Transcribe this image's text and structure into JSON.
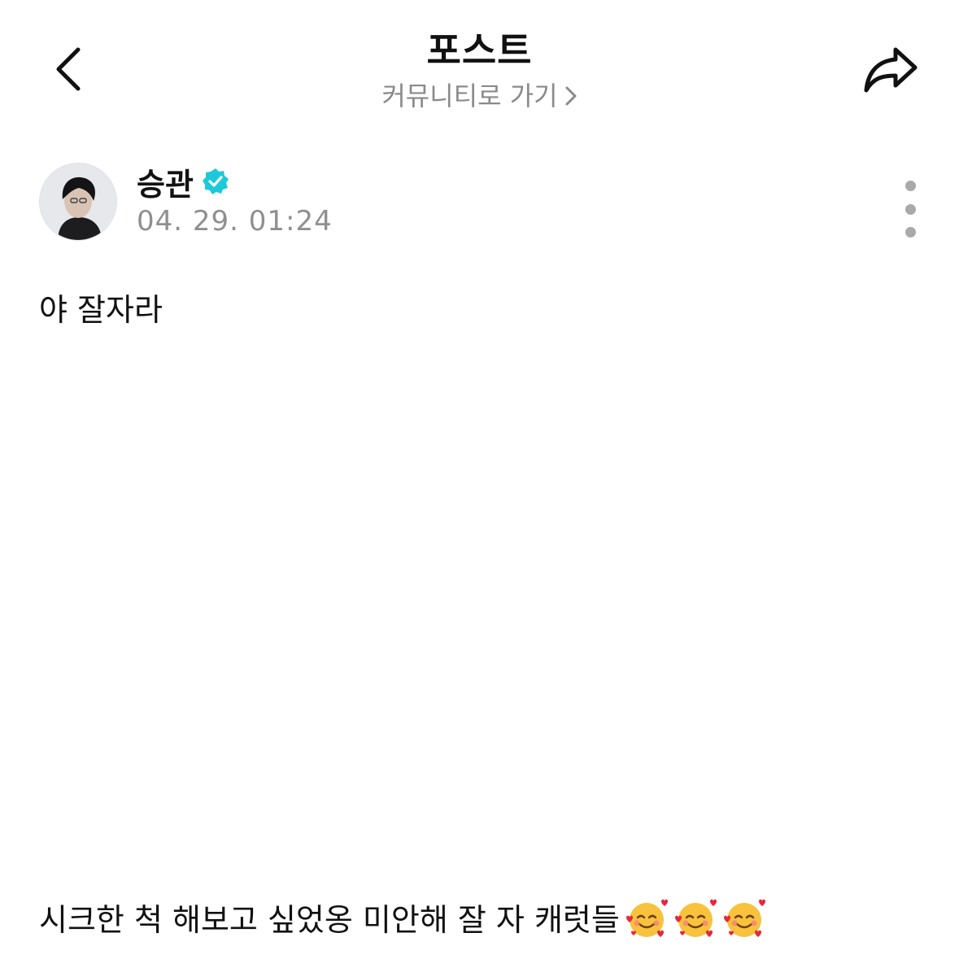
{
  "header": {
    "title": "포스트",
    "community_link": "커뮤니티로 가기",
    "back_icon": "chevron-left-icon",
    "share_icon": "share-arrow-icon"
  },
  "post": {
    "author": {
      "name": "승관",
      "verified": true,
      "verified_color": "#1cc9d9",
      "avatar_icon": "avatar-photo"
    },
    "timestamp": "04. 29. 01:24",
    "more_icon": "more-vertical-icon",
    "content": {
      "line1": "야 잘자라",
      "line2": "시크한 척 해보고 싶었옹 미안해 잘 자 캐럿들",
      "emojis": [
        "smiling-face-with-hearts",
        "smiling-face-with-hearts",
        "smiling-face-with-hearts"
      ]
    }
  },
  "colors": {
    "text_primary": "#111111",
    "text_secondary": "#8a8a8a",
    "accent": "#1cc9d9"
  }
}
